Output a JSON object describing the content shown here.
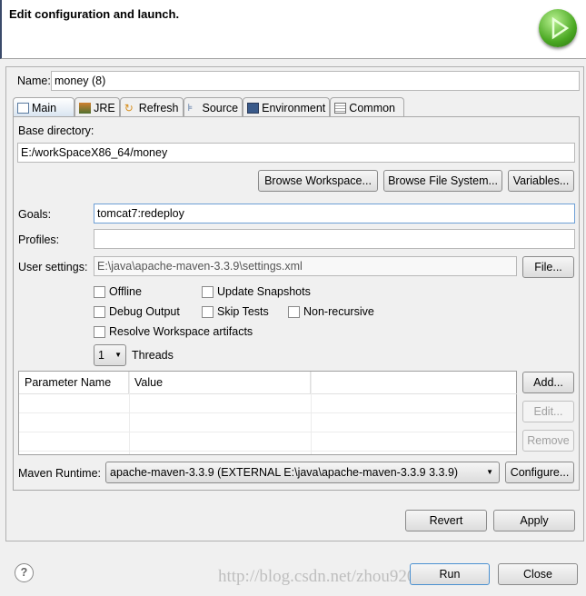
{
  "header": {
    "title": "Edit configuration and launch.",
    "icon": "run-icon"
  },
  "name": {
    "label": "Name:",
    "value": "money (8)"
  },
  "tabs": [
    {
      "label": "Main",
      "icon": "main-tab-icon"
    },
    {
      "label": "JRE",
      "icon": "jre-icon"
    },
    {
      "label": "Refresh",
      "icon": "refresh-icon"
    },
    {
      "label": "Source",
      "icon": "source-icon"
    },
    {
      "label": "Environment",
      "icon": "environment-icon"
    },
    {
      "label": "Common",
      "icon": "common-icon"
    }
  ],
  "main": {
    "base_dir_label": "Base directory:",
    "base_dir_value": "E:/workSpaceX86_64/money",
    "browse_workspace": "Browse Workspace...",
    "browse_fs": "Browse File System...",
    "variables": "Variables...",
    "goals_label": "Goals:",
    "goals_value": "tomcat7:redeploy",
    "profiles_label": "Profiles:",
    "profiles_value": "",
    "user_settings_label": "User settings:",
    "user_settings_value": "E:\\java\\apache-maven-3.3.9\\settings.xml",
    "file_button": "File...",
    "checkboxes": {
      "offline": "Offline",
      "update_snapshots": "Update Snapshots",
      "debug_output": "Debug Output",
      "skip_tests": "Skip Tests",
      "non_recursive": "Non-recursive",
      "resolve_ws": "Resolve Workspace artifacts"
    },
    "threads_value": "1",
    "threads_label": "Threads",
    "table": {
      "columns": [
        "Parameter Name",
        "Value"
      ],
      "rows": []
    },
    "add": "Add...",
    "edit": "Edit...",
    "remove": "Remove",
    "runtime_label": "Maven Runtime:",
    "runtime_value": "apache-maven-3.3.9 (EXTERNAL E:\\java\\apache-maven-3.3.9 3.3.9)",
    "configure": "Configure..."
  },
  "revert": "Revert",
  "apply": "Apply",
  "run": "Run",
  "close": "Close",
  "watermark": "http://blog.csdn.net/zhou920786312"
}
